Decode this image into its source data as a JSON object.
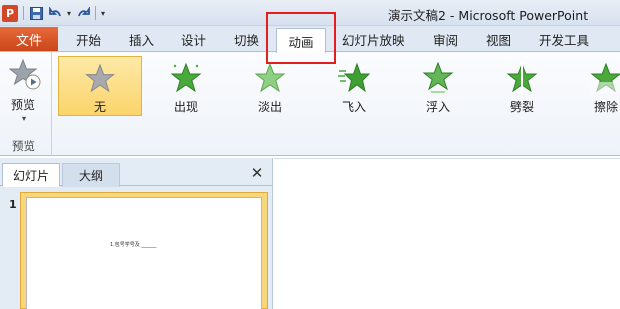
{
  "window": {
    "title": "演示文稿2 - Microsoft PowerPoint",
    "app_icon": "P"
  },
  "tabs": {
    "file": "文件",
    "items": [
      "开始",
      "插入",
      "设计",
      "切换",
      "动画",
      "幻灯片放映",
      "审阅",
      "视图",
      "开发工具"
    ],
    "active": "动画"
  },
  "ribbon": {
    "preview_label": "预览",
    "preview_group_label": "预览",
    "effects": [
      {
        "label": "无",
        "icon": "star-gray-icon",
        "selected": true
      },
      {
        "label": "出现",
        "icon": "star-appear-icon"
      },
      {
        "label": "淡出",
        "icon": "star-fade-icon"
      },
      {
        "label": "飞入",
        "icon": "star-fly-icon"
      },
      {
        "label": "浮入",
        "icon": "star-float-icon"
      },
      {
        "label": "劈裂",
        "icon": "star-split-icon"
      },
      {
        "label": "擦除",
        "icon": "star-wipe-icon"
      }
    ]
  },
  "panel": {
    "tab_slides": "幻灯片",
    "tab_outline": "大纲",
    "close": "✕",
    "slide_number": "1",
    "thumb_text": "1.包号学号及 ______"
  },
  "colors": {
    "accent": "#2b579a",
    "file_tab": "#d24726",
    "highlight": "#e1201b",
    "selected_effect": "#fbd46b"
  }
}
